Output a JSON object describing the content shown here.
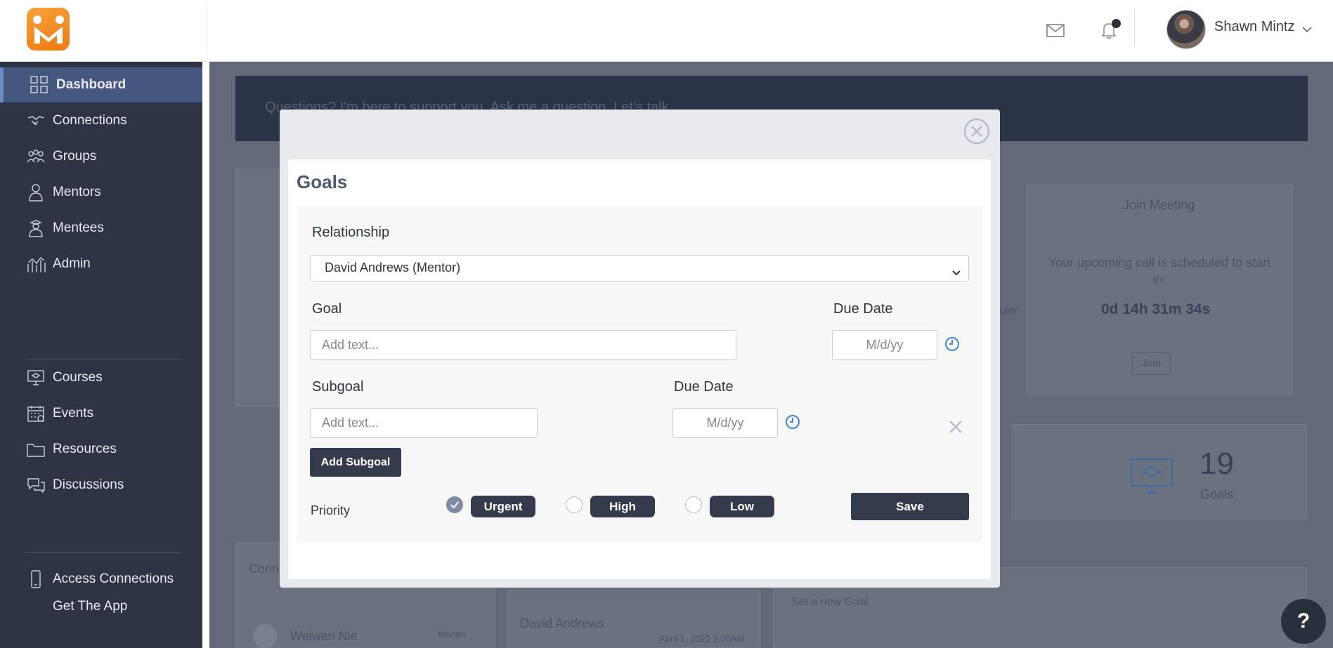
{
  "header": {
    "user_name": "Shawn Mintz"
  },
  "sidebar": {
    "items": [
      {
        "label": "Dashboard",
        "icon": "grid-icon"
      },
      {
        "label": "Connections",
        "icon": "handshake-icon"
      },
      {
        "label": "Groups",
        "icon": "group-icon"
      },
      {
        "label": "Mentors",
        "icon": "mentor-icon"
      },
      {
        "label": "Mentees",
        "icon": "mentee-icon"
      },
      {
        "label": "Admin",
        "icon": "chart-icon"
      }
    ],
    "items2": [
      {
        "label": "Courses",
        "icon": "monitor-icon"
      },
      {
        "label": "Events",
        "icon": "calendar-icon"
      },
      {
        "label": "Resources",
        "icon": "folder-icon"
      },
      {
        "label": "Discussions",
        "icon": "chat-icon"
      }
    ],
    "footer": {
      "access_label": "Access Connections",
      "app_label": "Get The App"
    }
  },
  "background": {
    "banner_text": "Questions? I'm here to support you. Ask me a question. Let's talk.",
    "join_title": "Join Meeting",
    "upcoming_text": "Your upcoming call is scheduled to start in:",
    "countdown": "0d 14h 31m 34s",
    "join_button": "Join",
    "scheduler_fragment": "uler",
    "goals_count": "19",
    "goals_label": "Goals",
    "connections_fragment": "Conn",
    "person1": "Weiwen Nie",
    "person1_role": "Mentor",
    "person2": "David Andrews",
    "person2_date": "April 1, 2022 9:00AM",
    "set_goal": "Set a new Goal"
  },
  "modal": {
    "title": "Goals",
    "relationship_label": "Relationship",
    "relationship_value": "David Andrews (Mentor)",
    "goal_label": "Goal",
    "goal_placeholder": "Add text...",
    "due_date_label": "Due Date",
    "date_placeholder": "M/d/yy",
    "subgoal_label": "Subgoal",
    "subgoal_placeholder": "Add text...",
    "subgoal_due_label": "Due Date",
    "add_subgoal_button": "Add Subgoal",
    "priority_label": "Priority",
    "priorities": [
      "Urgent",
      "High",
      "Low"
    ],
    "selected_priority": "Urgent",
    "save_button": "Save"
  },
  "help_label": "?"
}
